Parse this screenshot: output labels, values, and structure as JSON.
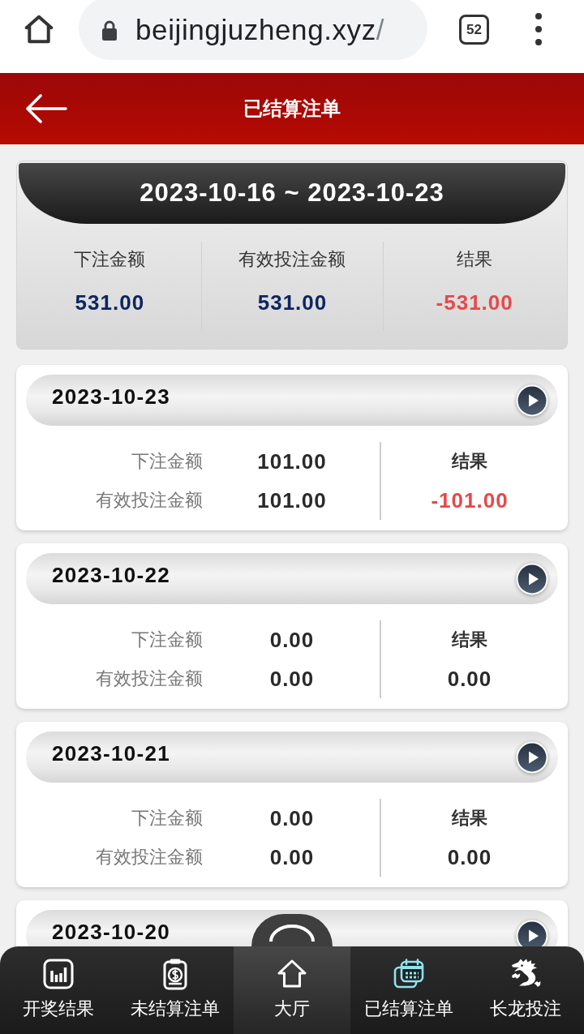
{
  "browser": {
    "domain": "beijingjuzheng.xyz",
    "path": "/",
    "tab_count": "52"
  },
  "header": {
    "title": "已结算注单"
  },
  "summary": {
    "range": "2023-10-16 ~ 2023-10-23",
    "stats": [
      {
        "label": "下注金额",
        "value": "531.00",
        "negative": false
      },
      {
        "label": "有效投注金额",
        "value": "531.00",
        "negative": false
      },
      {
        "label": "结果",
        "value": "-531.00",
        "negative": true
      }
    ]
  },
  "days": [
    {
      "date": "2023-10-23",
      "rows": [
        {
          "label": "下注金额",
          "value": "101.00"
        },
        {
          "label": "有效投注金额",
          "value": "101.00"
        }
      ],
      "result": {
        "label": "结果",
        "value": "-101.00",
        "negative": true
      }
    },
    {
      "date": "2023-10-22",
      "rows": [
        {
          "label": "下注金额",
          "value": "0.00"
        },
        {
          "label": "有效投注金额",
          "value": "0.00"
        }
      ],
      "result": {
        "label": "结果",
        "value": "0.00",
        "negative": false
      }
    },
    {
      "date": "2023-10-21",
      "rows": [
        {
          "label": "下注金额",
          "value": "0.00"
        },
        {
          "label": "有效投注金额",
          "value": "0.00"
        }
      ],
      "result": {
        "label": "结果",
        "value": "0.00",
        "negative": false
      }
    },
    {
      "date": "2023-10-20"
    }
  ],
  "bottom_nav": [
    {
      "label": "开奖结果",
      "kind": "tab",
      "selected": false
    },
    {
      "label": "未结算注单",
      "kind": "tab",
      "selected": false
    },
    {
      "label": "大厅",
      "kind": "hub",
      "selected": false
    },
    {
      "label": "已结算注单",
      "kind": "tab",
      "selected": true
    },
    {
      "label": "长龙投注",
      "kind": "tab",
      "selected": false
    }
  ]
}
